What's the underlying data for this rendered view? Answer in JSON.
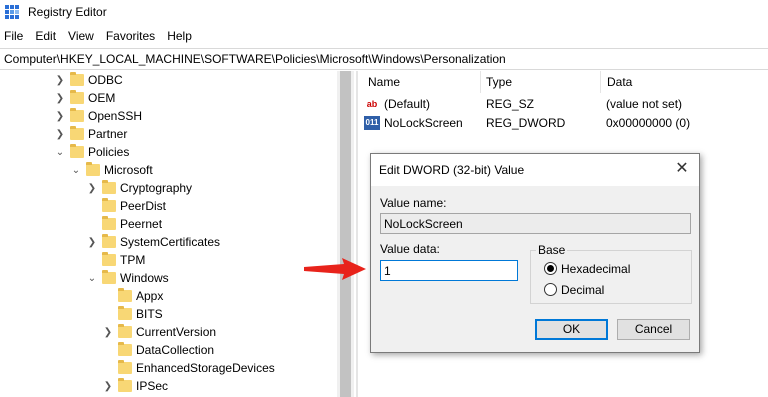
{
  "window": {
    "title": "Registry Editor"
  },
  "menu": [
    "File",
    "Edit",
    "View",
    "Favorites",
    "Help"
  ],
  "address": "Computer\\HKEY_LOCAL_MACHINE\\SOFTWARE\\Policies\\Microsoft\\Windows\\Personalization",
  "tree": [
    {
      "label": "ODBC"
    },
    {
      "label": "OEM"
    },
    {
      "label": "OpenSSH"
    },
    {
      "label": "Partner"
    },
    {
      "label": "Policies"
    },
    {
      "label": "Microsoft"
    },
    {
      "label": "Cryptography"
    },
    {
      "label": "PeerDist"
    },
    {
      "label": "Peernet"
    },
    {
      "label": "SystemCertificates"
    },
    {
      "label": "TPM"
    },
    {
      "label": "Windows"
    },
    {
      "label": "Appx"
    },
    {
      "label": "BITS"
    },
    {
      "label": "CurrentVersion"
    },
    {
      "label": "DataCollection"
    },
    {
      "label": "EnhancedStorageDevices"
    },
    {
      "label": "IPSec"
    }
  ],
  "list": {
    "columns": [
      "Name",
      "Type",
      "Data"
    ],
    "rows": [
      {
        "icon": "string-value-icon",
        "name": "(Default)",
        "type": "REG_SZ",
        "data": "(value not set)"
      },
      {
        "icon": "binary-value-icon",
        "name": "NoLockScreen",
        "type": "REG_DWORD",
        "data": "0x00000000 (0)"
      }
    ]
  },
  "dialog": {
    "title": "Edit DWORD (32-bit) Value",
    "value_name_label": "Value name:",
    "value_name": "NoLockScreen",
    "value_data_label": "Value data:",
    "value_data": "1",
    "base_label": "Base",
    "base_options": [
      "Hexadecimal",
      "Decimal"
    ],
    "base_selected": "Hexadecimal",
    "ok_label": "OK",
    "cancel_label": "Cancel"
  },
  "colors": {
    "folder": "#f8d775",
    "accent": "#0078d7",
    "arrow": "#e8231b"
  }
}
